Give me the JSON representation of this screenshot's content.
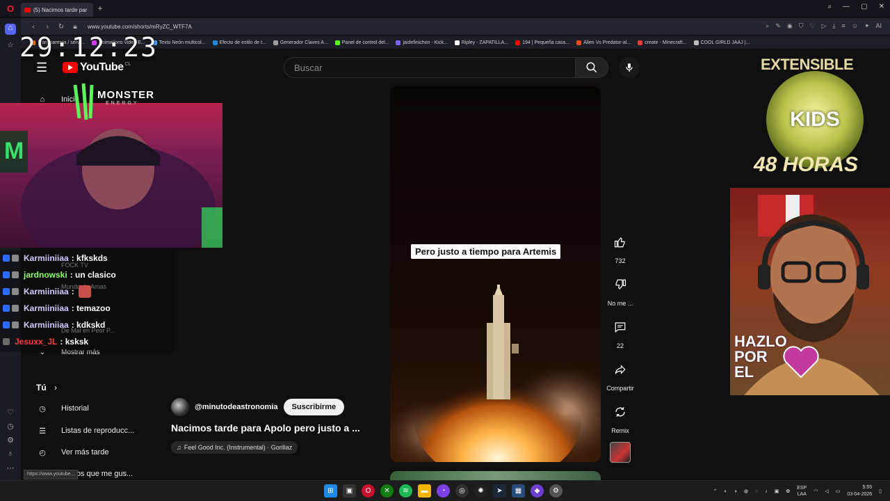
{
  "browser": {
    "tab_title": "(5) Nacimos tarde par",
    "url": "www.youtube.com/shorts/mRyZC_WTF7A",
    "bookmarks": [
      "Transparenta / servi...",
      "Animations Video E...",
      "Texto Neón multicol...",
      "Efecto de estilo de t...",
      "Generador Claves A...",
      "Panel de control del...",
      "jaidefinichon - Kick...",
      "Ripley - ZAPATILLA...",
      "194 | Pequeña casa...",
      "Alien Vs Predator-al...",
      "create - Minecraft...",
      "COOL GIRLD JAAJ |..."
    ],
    "hover_url": "https://www.youtube..."
  },
  "youtube": {
    "logo_text": "YouTube",
    "country_code": "CL",
    "search_placeholder": "Buscar",
    "sidebar": {
      "home_label": "Inicio",
      "sub_1": "FOCK TV",
      "sub_2": "Mundo de Amas",
      "sub_3": "De Mal en Peor P...",
      "show_more": "Mostrar más",
      "you_section": "Tú",
      "history": "Historial",
      "playlists": "Listas de reproducc...",
      "watch_later": "Ver más tarde",
      "liked": "Videos que me gus..."
    },
    "short": {
      "caption": "Pero justo a tiempo para Artemis",
      "channel": "@minutodeastronomia",
      "subscribe_label": "Suscribirme",
      "title": "Nacimos tarde para Apolo pero justo a ...",
      "music": "Feel Good Inc. (Instrumental) · Gorillaz"
    },
    "actions": {
      "like_count": "732",
      "dislike_label": "No me ...",
      "comments_count": "22",
      "share_label": "Compartir",
      "remix_label": "Remix"
    }
  },
  "overlay": {
    "timer": "29:12:23",
    "monster_text": "MONSTER",
    "energy_text": "ENERGY",
    "extensible": "EXTENSIBLE",
    "kids": "KIDS",
    "horas": "48 HORAS",
    "hazlo_1": "HAZLO",
    "hazlo_2": "POR",
    "hazlo_3": "EL",
    "chat": [
      {
        "nick": "Karmiiniiaa",
        "msg": ": kfkskds",
        "color": "#d7c7ff"
      },
      {
        "nick": "jardnowski",
        "msg": ": un clasico",
        "color": "#8dff6a"
      },
      {
        "nick": "Karmiiniiaa",
        "msg": ":",
        "color": "#d7c7ff"
      },
      {
        "nick": "Karmiiniiaa",
        "msg": ": temazoo",
        "color": "#d7c7ff"
      },
      {
        "nick": "Karmiiniiaa",
        "msg": ": kdkskd",
        "color": "#d7c7ff"
      },
      {
        "nick": "Jesuxx_JL",
        "msg": ": ksksk",
        "color": "#ff3b3b"
      }
    ]
  },
  "taskbar": {
    "lang_1": "ESP",
    "lang_2": "LAA",
    "time": "5:55",
    "date": "03-04-2026"
  },
  "colors": {
    "yt_red": "#ff0000",
    "subscribe_bg": "#f1f1f1",
    "page_bg": "#0f0f0f"
  }
}
